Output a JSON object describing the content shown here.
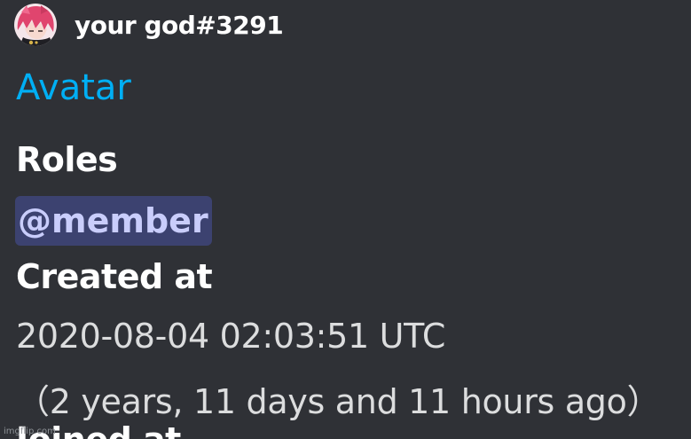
{
  "embed": {
    "author": {
      "name": "your god#3291",
      "avatar_icon": "pink-haired-anime-avatar-icon"
    },
    "avatar_link": "Avatar",
    "fields": {
      "roles_label": "Roles",
      "role_mention": "@member",
      "created_label": "Created at",
      "created_date": "2020-08-04 02:03:51 UTC",
      "created_relative": "（2 years, 11 days and 11 hours ago）",
      "next_label_partial": "Joined at"
    }
  },
  "watermark": "imgflip.com",
  "colors": {
    "background": "#2f3136",
    "link": "#00aff4",
    "heading": "#ffffff",
    "text": "#dcddde",
    "mention_bg": "#3c4270",
    "mention_text": "#c9cdfb"
  }
}
